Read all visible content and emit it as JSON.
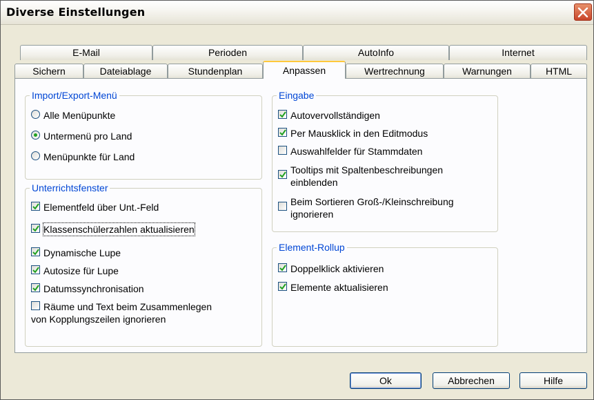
{
  "window": {
    "title": "Diverse Einstellungen"
  },
  "tabs_row1": [
    "E-Mail",
    "Perioden",
    "AutoInfo",
    "Internet"
  ],
  "tabs_row2": [
    "Sichern",
    "Dateiablage",
    "Stundenplan",
    "Anpassen",
    "Wertrechnung",
    "Warnungen",
    "HTML"
  ],
  "active_tab": "Anpassen",
  "import_export": {
    "title": "Import/Export-Menü",
    "options": [
      {
        "label": "Alle Menüpunkte",
        "selected": false
      },
      {
        "label": "Untermenü pro Land",
        "selected": true
      },
      {
        "label": "Menüpunkte für Land",
        "selected": false
      }
    ]
  },
  "unterricht": {
    "title": "Unterrichtsfenster",
    "items": [
      {
        "label": "Elementfeld über Unt.-Feld",
        "checked": true
      },
      {
        "label": "Klassenschülerzahlen aktualisieren",
        "checked": true
      },
      {
        "label": "Dynamische Lupe",
        "checked": true
      },
      {
        "label": "Autosize für Lupe",
        "checked": true
      },
      {
        "label": "Datumssynchronisation",
        "checked": true
      },
      {
        "label": "Räume und Text beim Zusammenlegen",
        "label2": "von Kopplungszeilen ignorieren",
        "checked": false
      }
    ]
  },
  "eingabe": {
    "title": "Eingabe",
    "items": [
      {
        "label": "Autovervollständigen",
        "checked": true
      },
      {
        "label": "Per Mausklick in den Editmodus",
        "checked": true
      },
      {
        "label": "Auswahlfelder für Stammdaten",
        "checked": false
      },
      {
        "label": "Tooltips mit Spaltenbeschreibungen",
        "label2": "einblenden",
        "checked": true
      },
      {
        "label": "Beim Sortieren Groß-/Kleinschreibung",
        "label2": "ignorieren",
        "checked": false
      }
    ]
  },
  "rollup": {
    "title": "Element-Rollup",
    "items": [
      {
        "label": "Doppelklick aktivieren",
        "checked": true
      },
      {
        "label": "Elemente aktualisieren",
        "checked": true
      }
    ]
  },
  "buttons": {
    "ok": "Ok",
    "cancel": "Abbrechen",
    "help": "Hilfe"
  },
  "colors": {
    "group_title": "#0046d5",
    "check": "#21a121",
    "active_tab_accent": "#ffc83c"
  }
}
